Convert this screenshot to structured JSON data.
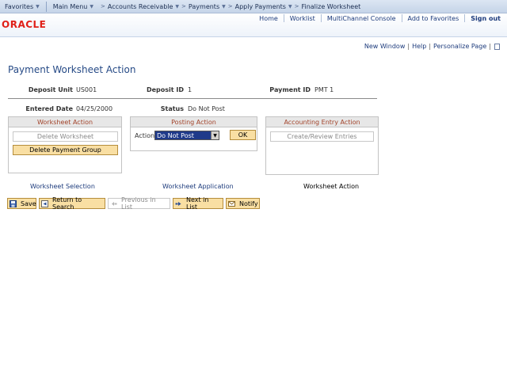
{
  "nav": {
    "favorites": "Favorites",
    "main_menu": "Main Menu",
    "breadcrumbs": [
      "Accounts Receivable",
      "Payments",
      "Apply Payments",
      "Finalize Worksheet"
    ]
  },
  "header": {
    "logo": "ORACLE",
    "links": [
      "Home",
      "Worklist",
      "MultiChannel Console",
      "Add to Favorites"
    ],
    "sign_out": "Sign out"
  },
  "utility": {
    "new_window": "New Window",
    "help": "Help",
    "personalize": "Personalize Page",
    "separator": "|"
  },
  "page": {
    "title": "Payment Worksheet Action"
  },
  "fields": {
    "deposit_unit_label": "Deposit Unit",
    "deposit_unit_value": "US001",
    "deposit_id_label": "Deposit ID",
    "deposit_id_value": "1",
    "payment_id_label": "Payment ID",
    "payment_id_value": "PMT 1",
    "entered_date_label": "Entered Date",
    "entered_date_value": "04/25/2000",
    "status_label": "Status",
    "status_value": "Do Not Post"
  },
  "worksheet_action": {
    "title": "Worksheet Action",
    "delete_worksheet": "Delete Worksheet",
    "delete_payment_group": "Delete Payment Group"
  },
  "posting_action": {
    "title": "Posting Action",
    "action_label": "Action:",
    "action_value": "Do Not Post",
    "ok": "OK"
  },
  "accounting_action": {
    "title": "Accounting Entry Action",
    "create_review": "Create/Review Entries"
  },
  "page_tabs": {
    "worksheet_selection": "Worksheet Selection",
    "worksheet_application": "Worksheet Application",
    "worksheet_action": "Worksheet Action"
  },
  "toolbar": {
    "save": "Save",
    "return_to_search": "Return to Search",
    "previous_in_list": "Previous in List",
    "next_in_list": "Next in List",
    "notify": "Notify"
  }
}
